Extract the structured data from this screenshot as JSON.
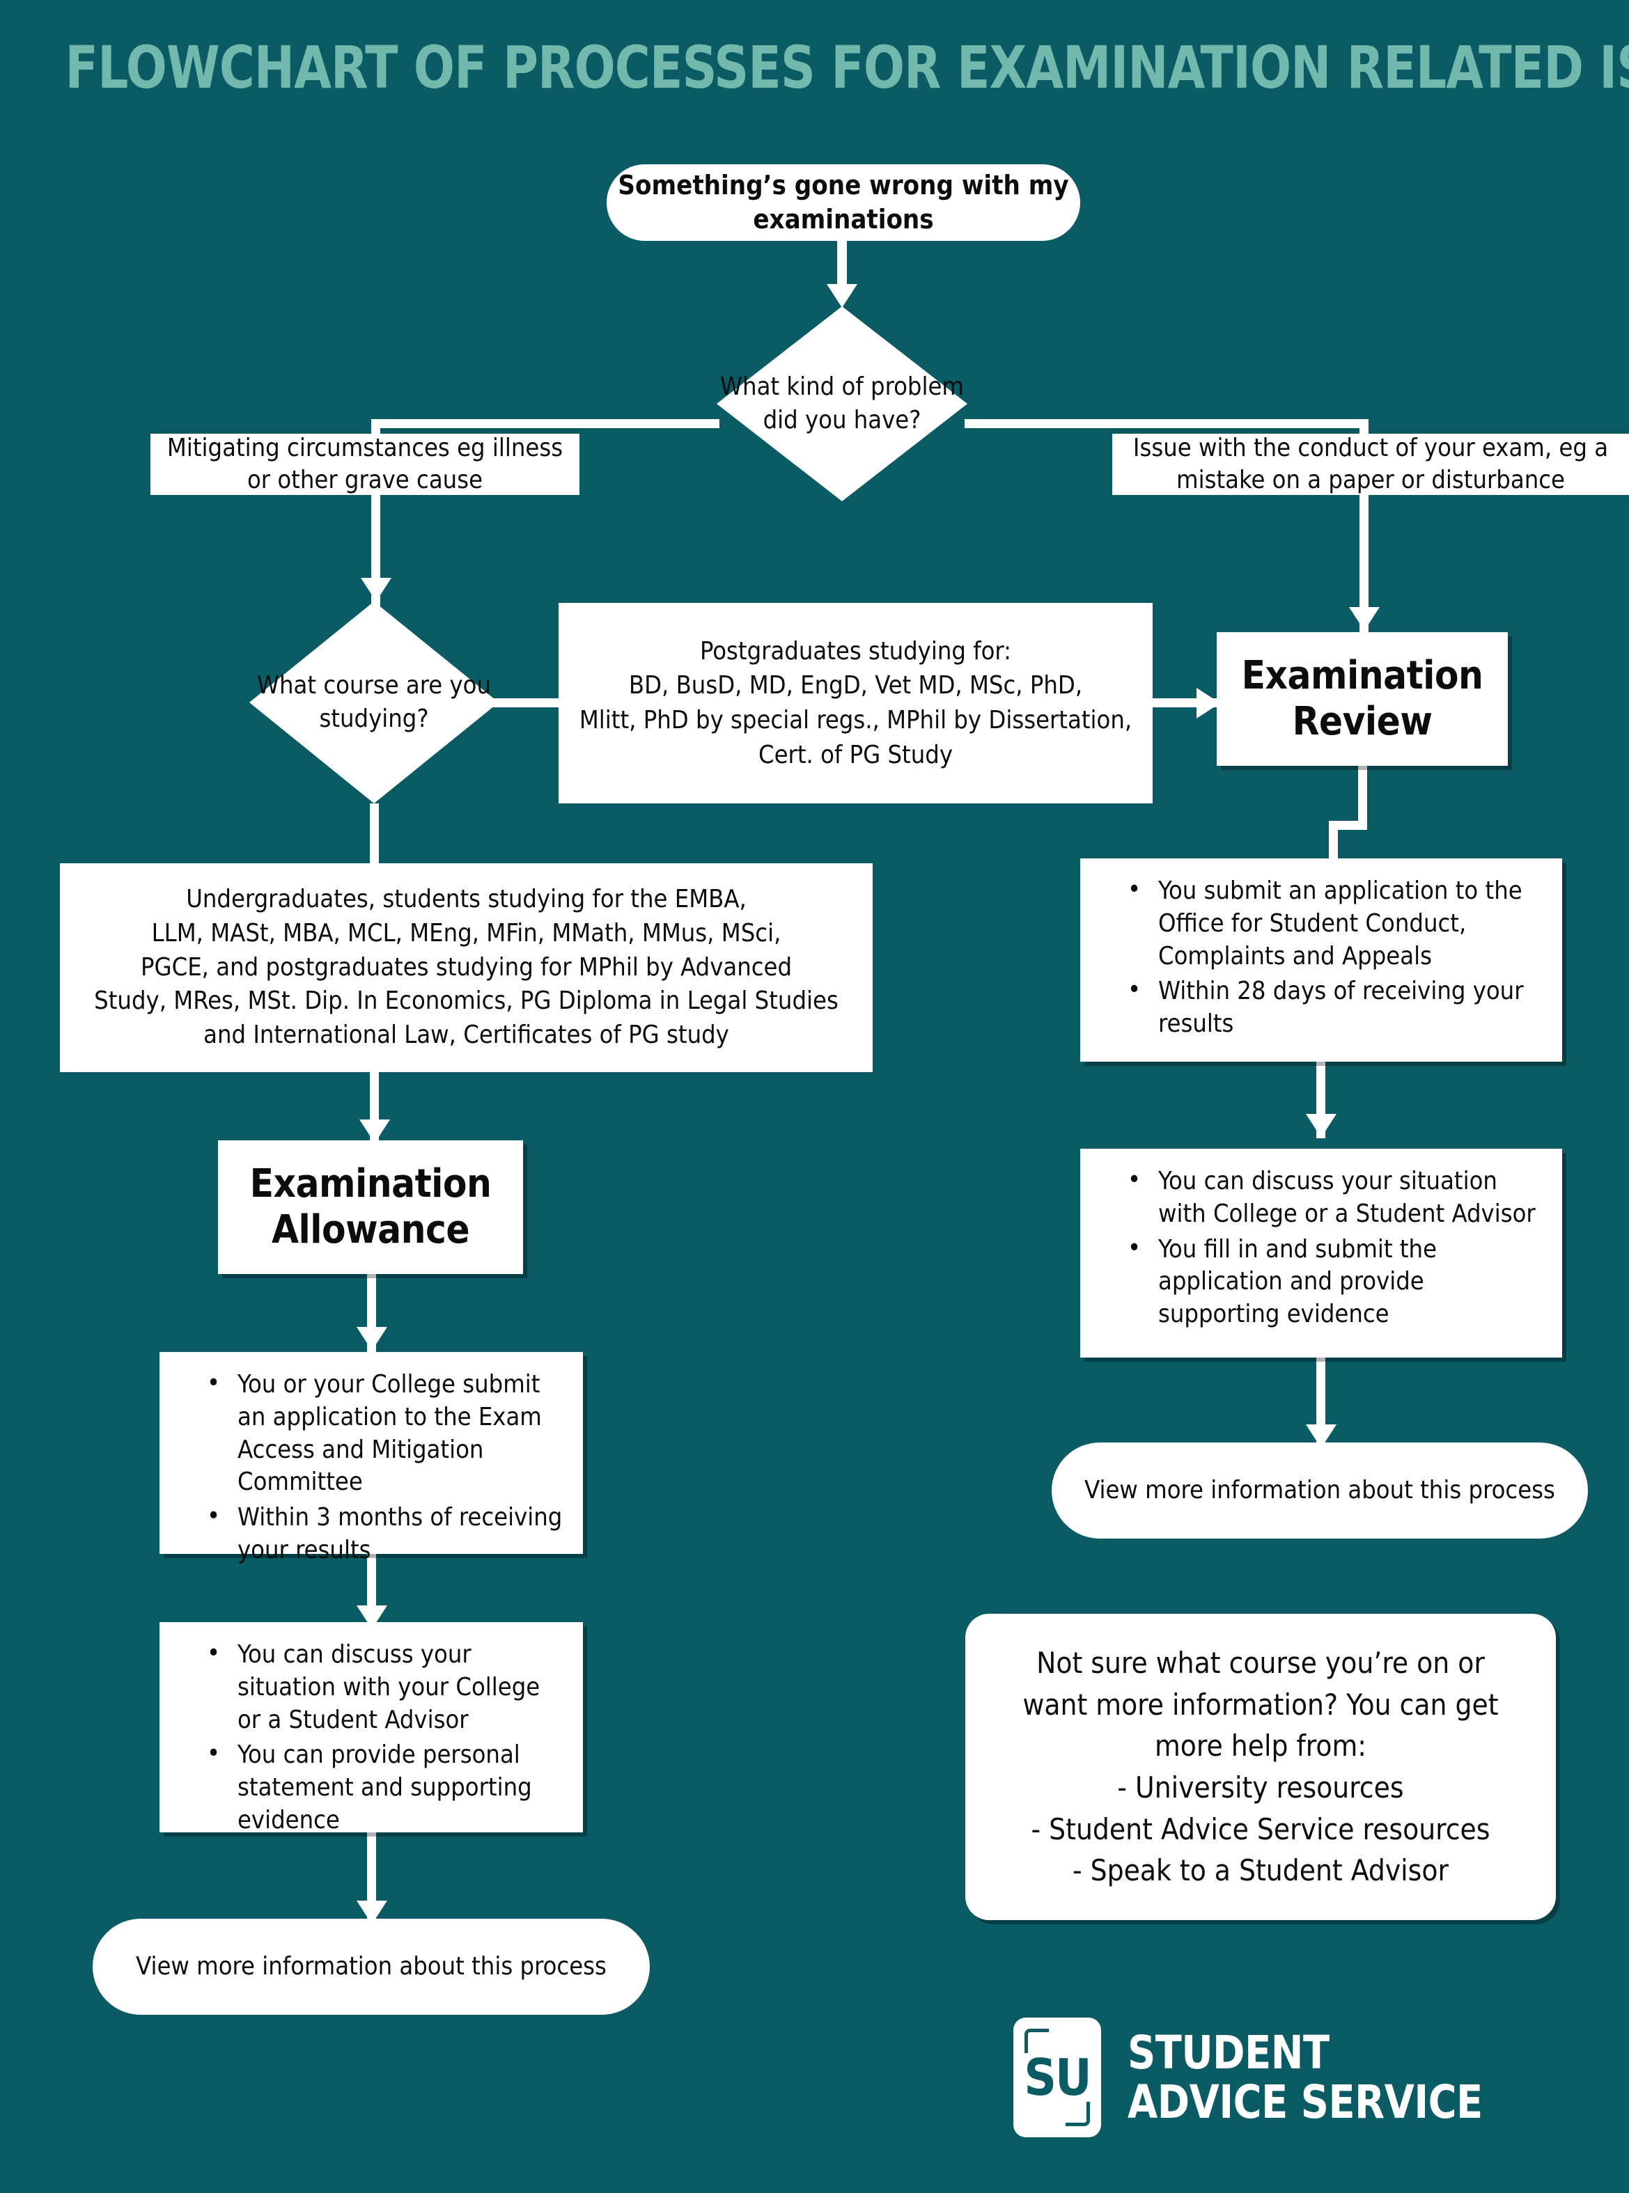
{
  "colors": {
    "background": "#0a5b63",
    "title": "#72b8ad",
    "node_fill": "#ffffff",
    "node_text": "#0c0c0c",
    "connector": "#ffffff"
  },
  "title": "FLOWCHART OF PROCESSES FOR EXAMINATION RELATED ISSUES",
  "nodes": {
    "start": "Something’s gone wrong with my examinations",
    "decision_problem": "What kind of problem did you have?",
    "branch_mitigating": "Mitigating circumstances eg illness or other grave cause",
    "branch_conduct": "Issue with the conduct of your exam, eg a mistake on a paper or disturbance",
    "decision_course": "What course are you studying?",
    "postgraduates": "Postgraduates studying for:\nBD, BusD, MD, EngD, Vet MD, MSc, PhD,\nMlitt, PhD by special regs., MPhil by Dissertation,\nCert. of PG Study",
    "postgraduates_lines": [
      "Postgraduates studying for:",
      "BD, BusD, MD, EngD, Vet MD, MSc, PhD,",
      "Mlitt, PhD by special regs., MPhil by Dissertation,",
      "Cert. of PG Study"
    ],
    "undergraduates_lines": [
      "Undergraduates, students studying for the EMBA,",
      "LLM, MASt, MBA, MCL, MEng, MFin, MMath, MMus, MSci,",
      "PGCE, and postgraduates studying for MPhil by Advanced",
      "Study, MRes, MSt. Dip. In Economics, PG Diploma in Legal Studies",
      "and International Law, Certificates of PG study"
    ],
    "examination_review": "Examination Review",
    "examination_allowance": "Examination Allowance",
    "review_step1_bullets": [
      "You submit an application to the Office for Student Conduct, Complaints and Appeals",
      "Within 28 days of receiving your results"
    ],
    "review_step2_bullets": [
      "You can discuss your situation with College or a Student Advisor",
      "You fill in and submit the application and provide supporting evidence"
    ],
    "allowance_step1_bullets": [
      "You or your College submit an application to the Exam Access and Mitigation Committee",
      "Within 3 months of receiving your results"
    ],
    "allowance_step2_bullets": [
      "You can discuss your situation with your College or a Student Advisor",
      "You can provide personal statement and supporting evidence"
    ],
    "view_more_left": "View more information about this process",
    "view_more_right": "View more information about this process",
    "help_box_lines": [
      "Not sure what course you’re on or",
      "want more information? You can get",
      "more help from:",
      "- University resources",
      "- Student Advice Service resources",
      "- Speak to a Student Advisor"
    ]
  },
  "logo": {
    "mark": "SU",
    "line1": "STUDENT",
    "line2": "ADVICE SERVICE"
  }
}
